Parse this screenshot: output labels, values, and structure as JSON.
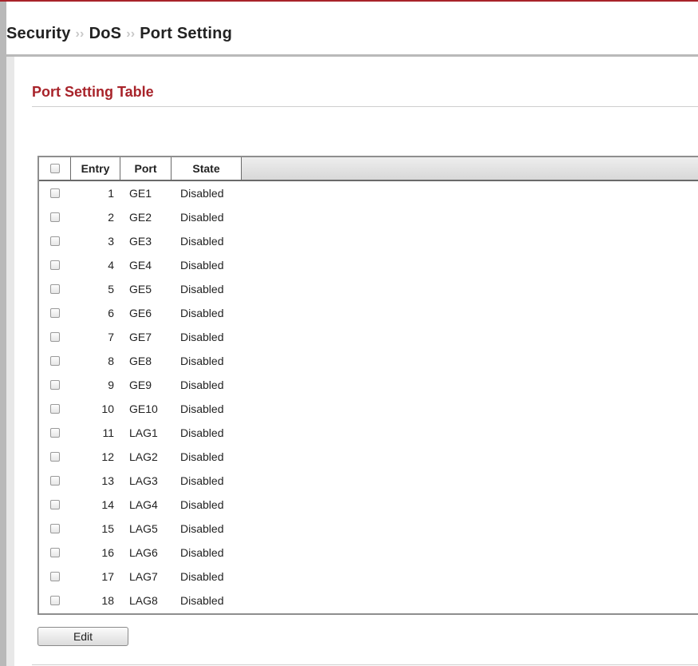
{
  "breadcrumb": {
    "items": [
      "Security",
      "DoS",
      "Port Setting"
    ],
    "separator": "››"
  },
  "section": {
    "title": "Port Setting Table"
  },
  "table": {
    "columns": [
      "Entry",
      "Port",
      "State"
    ],
    "rows": [
      {
        "entry": "1",
        "port": "GE1",
        "state": "Disabled"
      },
      {
        "entry": "2",
        "port": "GE2",
        "state": "Disabled"
      },
      {
        "entry": "3",
        "port": "GE3",
        "state": "Disabled"
      },
      {
        "entry": "4",
        "port": "GE4",
        "state": "Disabled"
      },
      {
        "entry": "5",
        "port": "GE5",
        "state": "Disabled"
      },
      {
        "entry": "6",
        "port": "GE6",
        "state": "Disabled"
      },
      {
        "entry": "7",
        "port": "GE7",
        "state": "Disabled"
      },
      {
        "entry": "8",
        "port": "GE8",
        "state": "Disabled"
      },
      {
        "entry": "9",
        "port": "GE9",
        "state": "Disabled"
      },
      {
        "entry": "10",
        "port": "GE10",
        "state": "Disabled"
      },
      {
        "entry": "11",
        "port": "LAG1",
        "state": "Disabled"
      },
      {
        "entry": "12",
        "port": "LAG2",
        "state": "Disabled"
      },
      {
        "entry": "13",
        "port": "LAG3",
        "state": "Disabled"
      },
      {
        "entry": "14",
        "port": "LAG4",
        "state": "Disabled"
      },
      {
        "entry": "15",
        "port": "LAG5",
        "state": "Disabled"
      },
      {
        "entry": "16",
        "port": "LAG6",
        "state": "Disabled"
      },
      {
        "entry": "17",
        "port": "LAG7",
        "state": "Disabled"
      },
      {
        "entry": "18",
        "port": "LAG8",
        "state": "Disabled"
      }
    ]
  },
  "actions": {
    "edit_label": "Edit"
  },
  "colors": {
    "accent": "#a8232a",
    "frame": "#b9b9b9"
  }
}
